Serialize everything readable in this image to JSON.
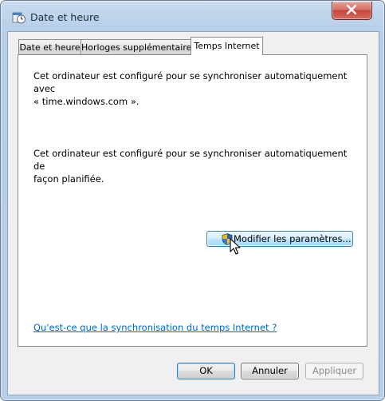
{
  "window": {
    "title": "Date et heure"
  },
  "tabs": [
    {
      "label": "Date et heure",
      "active": false
    },
    {
      "label": "Horloges supplémentaires",
      "active": false
    },
    {
      "label": "Temps Internet",
      "active": true
    }
  ],
  "internet_time": {
    "text_server_line1": "Cet ordinateur est configuré pour se synchroniser automatiquement avec",
    "text_server_line2": "« time.windows.com ».",
    "text_schedule_line1": "Cet ordinateur est configuré pour se synchroniser automatiquement de",
    "text_schedule_line2": "façon planifiée.",
    "modify_button_label": "Modifier les paramètres...",
    "help_link": "Qu'est-ce que la synchronisation du temps Internet ?"
  },
  "buttons": {
    "ok": "OK",
    "cancel": "Annuler",
    "apply": "Appliquer"
  },
  "icons": {
    "app": "clock-calendar-icon",
    "shield": "uac-shield-icon",
    "close": "close-icon"
  },
  "colors": {
    "link": "#0066cc",
    "close_button": "#c7473b",
    "hover_button": "#bee6fd"
  }
}
